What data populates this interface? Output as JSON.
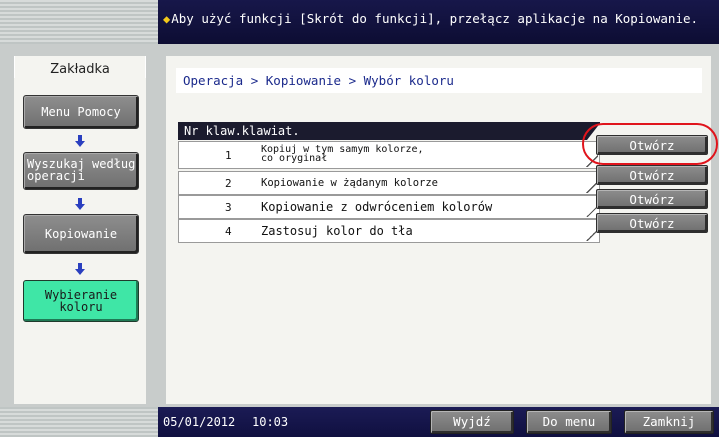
{
  "banner": {
    "message": "Aby użyć funkcji [Skrót do funkcji], przełącz aplikacje na Kopiowanie.",
    "warn_icon": "◆"
  },
  "sidebar": {
    "tab_label": "Zakładka",
    "items": [
      {
        "label": "Menu Pomocy",
        "selected": false
      },
      {
        "label": "Wyszukaj według\noperacji",
        "selected": false
      },
      {
        "label": "Kopiowanie",
        "selected": false
      },
      {
        "label": "Wybieranie\nkoloru",
        "selected": true
      }
    ]
  },
  "breadcrumb": "Operacja > Kopiowanie > Wybór koloru",
  "list": {
    "header": "Nr klaw.klawiat.",
    "rows": [
      {
        "num": "1",
        "text": "Kopiuj w tym samym kolorze,\nco oryginał",
        "button": "Otwórz",
        "highlighted": true
      },
      {
        "num": "2",
        "text": "Kopiowanie w żądanym kolorze",
        "button": "Otwórz",
        "highlighted": false
      },
      {
        "num": "3",
        "text": "Kopiowanie z odwróceniem kolorów",
        "button": "Otwórz",
        "highlighted": false
      },
      {
        "num": "4",
        "text": "Zastosuj kolor do tła",
        "button": "Otwórz",
        "highlighted": false
      }
    ]
  },
  "status": {
    "date": "05/01/2012",
    "time": "10:03"
  },
  "footer_buttons": {
    "exit": "Wyjdź",
    "to_menu": "Do menu",
    "close": "Zamknij"
  },
  "colors": {
    "banner_bg": "#0d0d33",
    "accent_green": "#3fe6a6",
    "highlight_red": "#e0141c",
    "button_gray": "#7a7a7a"
  }
}
